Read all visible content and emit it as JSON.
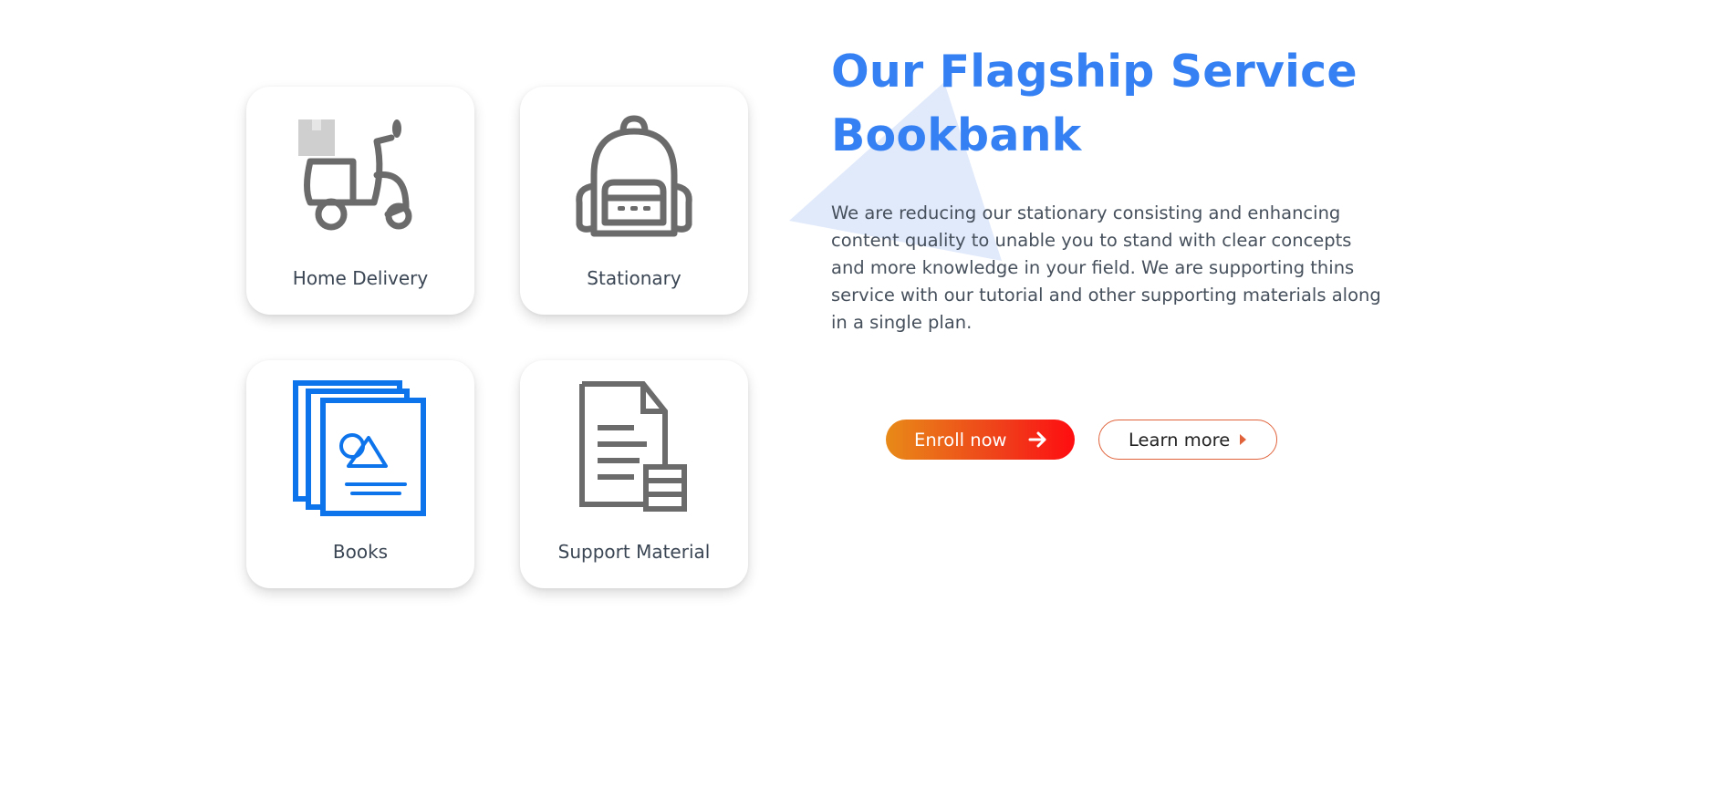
{
  "services": [
    {
      "label": "Home Delivery",
      "icon": "scooter-delivery-icon"
    },
    {
      "label": "Stationary",
      "icon": "backpack-icon"
    },
    {
      "label": "Books",
      "icon": "books-stack-icon"
    },
    {
      "label": "Support Material",
      "icon": "document-icon"
    }
  ],
  "hero": {
    "title_line1": "Our Flagship Service",
    "title_line2": "Bookbank",
    "description": "We are reducing our stationary consisting and enhancing content quality to unable you to stand with clear concepts and more knowledge in your field. We are supporting thins service with our tutorial and other supporting materials along in a single plan."
  },
  "buttons": {
    "enroll_label": "Enroll now",
    "learn_label": "Learn more"
  },
  "colors": {
    "accent_blue": "#3581f3",
    "icon_gray": "#6b6b6b",
    "books_blue": "#0d74ec",
    "enroll_gradient_start": "#e88a18",
    "enroll_gradient_end": "#ff0d10",
    "learn_border": "#e0623a"
  }
}
